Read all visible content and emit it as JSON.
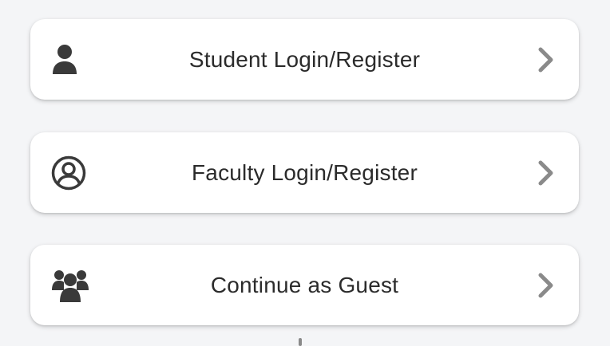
{
  "options": [
    {
      "label": "Student Login/Register",
      "icon": "user-icon"
    },
    {
      "label": "Faculty Login/Register",
      "icon": "user-circle-icon"
    },
    {
      "label": "Continue as Guest",
      "icon": "users-group-icon"
    }
  ],
  "colors": {
    "background": "#f4f5f7",
    "card": "#ffffff",
    "text": "#2b2b2b",
    "icon": "#3a3a3a",
    "chevron": "#8a8a8a"
  }
}
